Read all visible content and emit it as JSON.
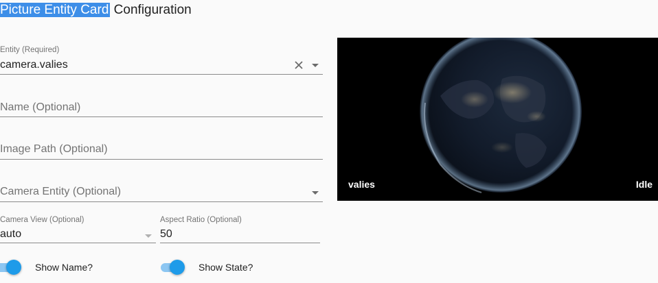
{
  "page": {
    "title_highlight": "Picture Entity Card",
    "title_rest": " Configuration"
  },
  "form": {
    "entity": {
      "label": "Entity (Required)",
      "value": "camera.valies"
    },
    "name": {
      "placeholder": "Name (Optional)"
    },
    "image_path": {
      "placeholder": "Image Path (Optional)"
    },
    "camera_entity": {
      "placeholder": "Camera Entity (Optional)"
    },
    "camera_view": {
      "label": "Camera View (Optional)",
      "value": "auto"
    },
    "aspect_ratio": {
      "label": "Aspect Ratio (Optional)",
      "value": "50"
    },
    "show_name": {
      "label": "Show Name?",
      "checked": true
    },
    "show_state": {
      "label": "Show State?",
      "checked": true
    }
  },
  "preview": {
    "name": "valies",
    "state": "Idle",
    "image": "earth-at-night-globe"
  },
  "colors": {
    "accent": "#1e9be9",
    "accent_track": "#8cc6f2",
    "title_highlight_bg": "#3d8ee8"
  }
}
